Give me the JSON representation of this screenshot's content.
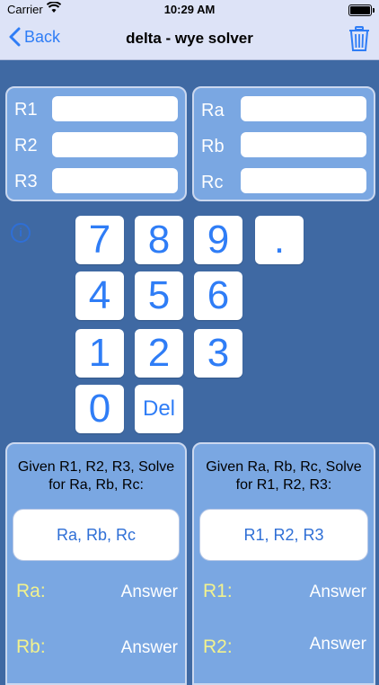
{
  "status": {
    "carrier": "Carrier",
    "time": "10:29 AM"
  },
  "nav": {
    "back": "Back",
    "title": "delta - wye solver"
  },
  "inputs_left": [
    {
      "label": "R1",
      "value": ""
    },
    {
      "label": "R2",
      "value": ""
    },
    {
      "label": "R3",
      "value": ""
    }
  ],
  "inputs_right": [
    {
      "label": "Ra",
      "value": ""
    },
    {
      "label": "Rb",
      "value": ""
    },
    {
      "label": "Rc",
      "value": ""
    }
  ],
  "info_icon": "i",
  "keypad": {
    "k7": "7",
    "k8": "8",
    "k9": "9",
    "dot": ".",
    "k4": "4",
    "k5": "5",
    "k6": "6",
    "k1": "1",
    "k2": "2",
    "k3": "3",
    "k0": "0",
    "del": "Del"
  },
  "solve_left": {
    "title_line1": "Given R1, R2, R3, Solve",
    "title_line2": "for Ra, Rb, Rc:",
    "button": "Ra, Rb, Rc",
    "results": [
      {
        "label": "Ra:",
        "value": "Answer"
      },
      {
        "label": "Rb:",
        "value": "Answer"
      }
    ]
  },
  "solve_right": {
    "title_line1": "Given Ra, Rb, Rc, Solve",
    "title_line2": "for R1, R2, R3:",
    "button": "R1, R2, R3",
    "results": [
      {
        "label": "R1:",
        "value": "Answer"
      },
      {
        "label": "R2:",
        "value": "Answer"
      }
    ]
  },
  "colors": {
    "background": "#3f69a3",
    "panel": "#7aa7e2",
    "accent": "#2f7df6",
    "answer_label": "#f2f28e",
    "bar": "#dde3f7"
  }
}
